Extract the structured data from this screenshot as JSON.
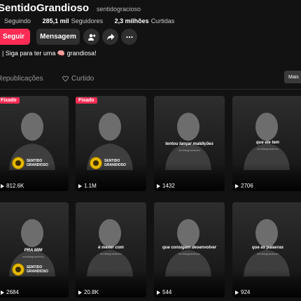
{
  "profile": {
    "username": "SentidoGrandioso",
    "handle": "sentidogracioso",
    "stats": {
      "following_value": "",
      "following_label": "Seguindo",
      "followers_value": "285,1 mil",
      "followers_label": "Seguidores",
      "likes_value": "2,3 milhões",
      "likes_label": "Curtidas"
    },
    "follow_label": "Seguir",
    "message_label": "Mensagem",
    "bio": "| Siga para ter uma 🧠 grandiosa!"
  },
  "tabs": {
    "items": [
      {
        "label": "Republicações"
      },
      {
        "label": "Curtido"
      }
    ],
    "more_label": "Mais"
  },
  "pinned_label": "Fixado",
  "logo_text": {
    "line1": "SENTIDO",
    "line2": "GRANDIOSO"
  },
  "videos": [
    {
      "views": "812.6K",
      "pinned": true,
      "caption": "",
      "logo": true
    },
    {
      "views": "1.1M",
      "pinned": true,
      "caption": "",
      "logo": true
    },
    {
      "views": "1432",
      "pinned": false,
      "caption": "tentou lançar maldições",
      "logo": false
    },
    {
      "views": "2706",
      "pinned": false,
      "caption": "que ele tem",
      "logo": false
    },
    {
      "views": "2684",
      "pinned": false,
      "caption": "PRA MIM",
      "logo": true
    },
    {
      "views": "20.8K",
      "pinned": false,
      "caption": "é mexer com",
      "logo": false
    },
    {
      "views": "544",
      "pinned": false,
      "caption": "que consigam desenvolver",
      "logo": false
    },
    {
      "views": "924",
      "pinned": false,
      "caption": "que as palavras",
      "logo": false
    }
  ],
  "watermark": "sentidograndioso",
  "icons": {
    "add_friend": "person-plus-icon",
    "share": "share-arrow-icon",
    "more": "more-dots-icon",
    "repost": "repost-icon",
    "liked": "heart-outline-icon",
    "views": "play-icon"
  },
  "colors": {
    "background": "#121212",
    "accent": "#fe2c55",
    "secondary_button": "#2f2f2f"
  }
}
